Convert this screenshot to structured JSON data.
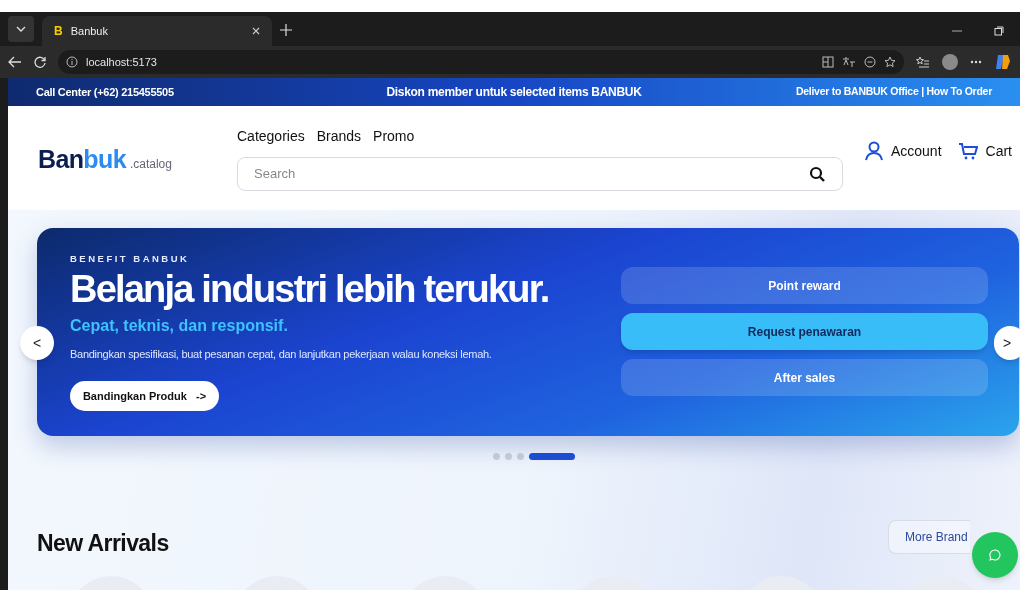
{
  "browser": {
    "tab_title": "Banbuk",
    "tab_favicon": "B",
    "url": "localhost:5173"
  },
  "promo_bar": {
    "left": "Call Center (+62) 215455505",
    "center": "Diskon member untuk selected items BANBUK",
    "right": "Deliver to BANBUK Office | **How To Order**"
  },
  "header": {
    "logo_main": "Ban",
    "logo_accent": "buk",
    "logo_suffix": ".catalog",
    "nav": [
      "Categories",
      "Brands",
      "Promo"
    ],
    "search": {
      "placeholder": "Search"
    },
    "account": "Account",
    "cart": "Cart"
  },
  "hero": {
    "eyebrow": "BENEFIT BANBUK",
    "title": "Belanja industri lebih terukur.",
    "subtitle": "Cepat, teknis, dan responsif.",
    "description": "Bandingkan spesifikasi, buat pesanan cepat, dan lanjutkan pekerjaan walau koneksi lemah.",
    "cta": "Bandingkan Produk   ->",
    "options": [
      {
        "label": "Point reward",
        "selected": false
      },
      {
        "label": "Request penawaran",
        "selected": true
      },
      {
        "label": "After sales",
        "selected": false
      }
    ],
    "prev": "<",
    "next": ">",
    "slides": [
      {
        "selected": false
      },
      {
        "selected": false
      },
      {
        "selected": false
      },
      {
        "selected": true
      }
    ]
  },
  "section": {
    "title": "New Arrivals",
    "more": "More Brand"
  }
}
